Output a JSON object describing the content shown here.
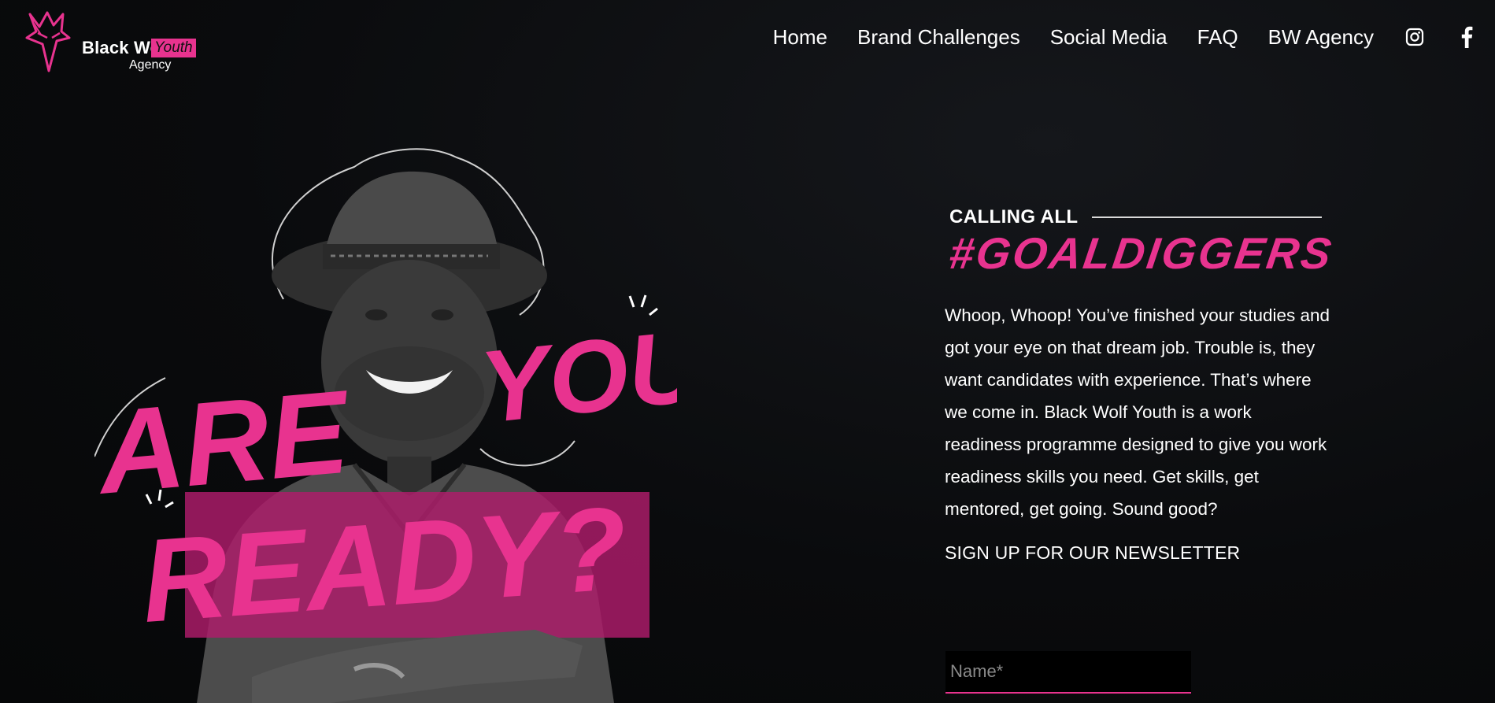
{
  "brand": {
    "name": "Black Wolf",
    "badge": "Youth",
    "sub": "Agency",
    "accent": "#e8338f"
  },
  "nav": {
    "items": [
      "Home",
      "Brand Challenges",
      "Social Media",
      "FAQ",
      "BW Agency"
    ],
    "social": [
      "instagram-icon",
      "facebook-icon"
    ]
  },
  "hero": {
    "headline_line1": "ARE",
    "headline_line1b": "YOU",
    "headline_line2": "READY?",
    "image": "portrait of smiling man in hat"
  },
  "content": {
    "calling": "CALLING ALL",
    "hashtag": "#GOALDIGGERS",
    "intro": "Whoop, Whoop! You’ve finished your studies and got your eye on that dream job. Trouble is, they want candidates with experience. That’s where we come in. Black Wolf Youth is a work readiness programme designed to give you work readiness skills you need. Get skills, get mentored, get going. Sound good?",
    "newsletter": "SIGN UP FOR OUR NEWSLETTER"
  },
  "form": {
    "name_placeholder": "Name*"
  }
}
